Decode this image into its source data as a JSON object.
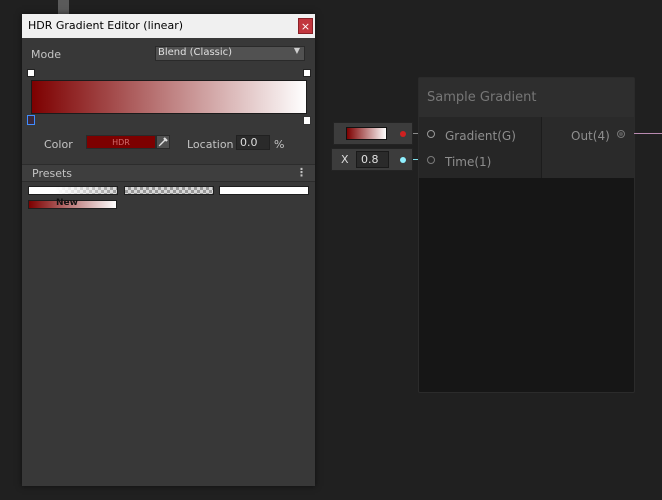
{
  "editor": {
    "title": "HDR Gradient Editor (linear)",
    "close_glyph": "×",
    "mode": {
      "label": "Mode",
      "value": "Blend (Classic)",
      "arrow_glyph": "▼"
    },
    "gradient": {
      "start_color": "#7d0000",
      "end_color": "#ffffff"
    },
    "color_label": "Color",
    "color_field_text": "HDR",
    "color_value": "#7d0000",
    "eyedropper_icon": "eyedropper-icon",
    "location_label": "Location",
    "location_value": "0.0",
    "percent_label": "%",
    "presets": {
      "label": "Presets",
      "menu_glyph": "⋮",
      "new_label": "New"
    }
  },
  "inputs": {
    "gradient_chip": {
      "port_color": "#d02020"
    },
    "time_chip": {
      "axis_label": "X",
      "value": "0.8",
      "port_color": "#8ff0ff"
    }
  },
  "node": {
    "title": "Sample Gradient",
    "inputs": [
      {
        "label": "Gradient(G)"
      },
      {
        "label": "Time(1)"
      }
    ],
    "output": {
      "label": "Out(4)"
    }
  }
}
